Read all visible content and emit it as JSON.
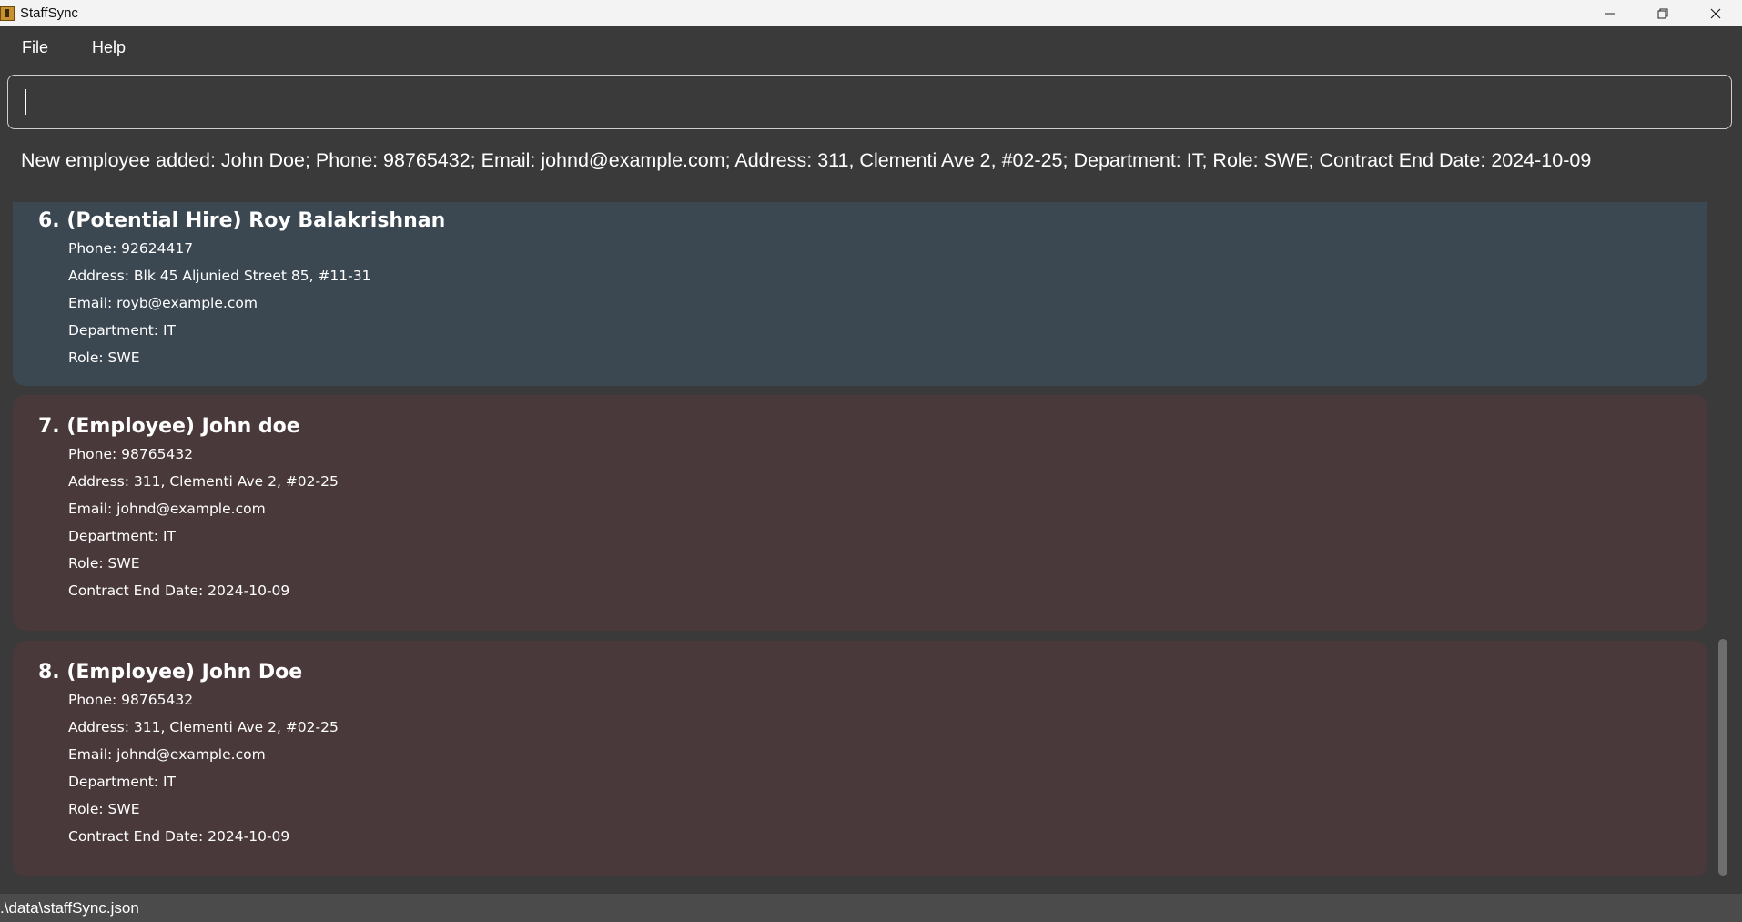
{
  "window": {
    "title": "StaffSync",
    "icon": "app-icon",
    "controls": [
      "minimize-icon",
      "restore-icon",
      "close-icon"
    ]
  },
  "menu": {
    "file": "File",
    "help": "Help"
  },
  "command": {
    "value": "",
    "placeholder": ""
  },
  "result": {
    "text": "New employee added: John Doe; Phone: 98765432; Email: johnd@example.com; Address: 311, Clementi Ave 2, #02-25; Department: IT; Role: SWE; Contract End Date: 2024-10-09"
  },
  "cards": [
    {
      "title": "6. (Potential Hire) Roy Balakrishnan",
      "type": "hire",
      "fields": [
        "Phone: 92624417",
        "Address: Blk 45 Aljunied Street 85, #11-31",
        "Email: royb@example.com",
        "Department: IT",
        "Role: SWE"
      ]
    },
    {
      "title": "7. (Employee) John doe",
      "type": "employee",
      "fields": [
        "Phone: 98765432",
        "Address: 311, Clementi Ave 2, #02-25",
        "Email: johnd@example.com",
        "Department: IT",
        "Role: SWE",
        "Contract End Date: 2024-10-09"
      ]
    },
    {
      "title": "8. (Employee) John Doe",
      "type": "employee",
      "fields": [
        "Phone: 98765432",
        "Address: 311, Clementi Ave 2, #02-25",
        "Email: johnd@example.com",
        "Department: IT",
        "Role: SWE",
        "Contract End Date: 2024-10-09"
      ]
    }
  ],
  "status": {
    "path": ".\\data\\staffSync.json"
  },
  "colors": {
    "background": "#3a3a3a",
    "hire_card": "#3b4751",
    "employee_card": "#4a393a",
    "statusbar": "#4b4b4b"
  }
}
